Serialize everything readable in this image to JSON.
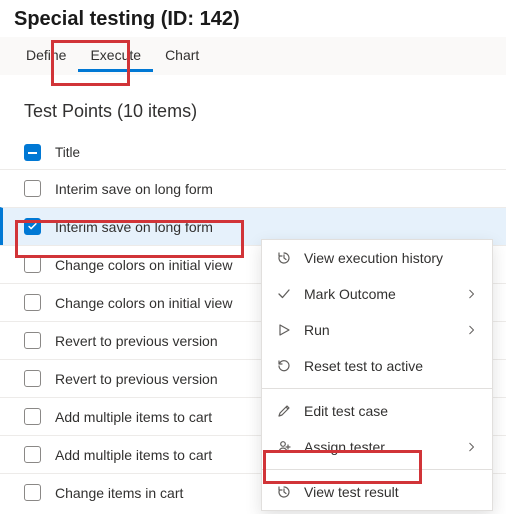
{
  "header": {
    "title": "Special testing (ID: 142)"
  },
  "tabs": {
    "items": [
      {
        "label": "Define"
      },
      {
        "label": "Execute"
      },
      {
        "label": "Chart"
      }
    ]
  },
  "section": {
    "title": "Test Points (10 items)",
    "column_title": "Title"
  },
  "rows": [
    {
      "title": "Interim save on long form"
    },
    {
      "title": "Interim save on long form"
    },
    {
      "title": "Change colors on initial view"
    },
    {
      "title": "Change colors on initial view"
    },
    {
      "title": "Revert to previous version"
    },
    {
      "title": "Revert to previous version"
    },
    {
      "title": "Add multiple items to cart"
    },
    {
      "title": "Add multiple items to cart"
    },
    {
      "title": "Change items in cart"
    }
  ],
  "menu": {
    "items": [
      {
        "label": "View execution history"
      },
      {
        "label": "Mark Outcome"
      },
      {
        "label": "Run"
      },
      {
        "label": "Reset test to active"
      },
      {
        "label": "Edit test case"
      },
      {
        "label": "Assign tester"
      },
      {
        "label": "View test result"
      }
    ]
  }
}
